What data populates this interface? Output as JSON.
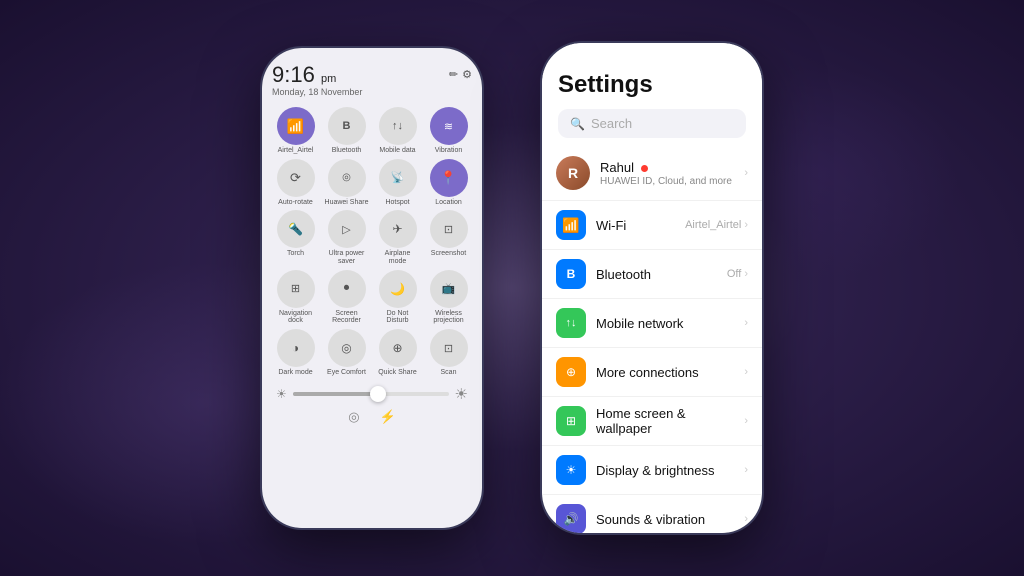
{
  "background": {
    "color": "#2d1f4a"
  },
  "left_phone": {
    "time": "9:16",
    "ampm": "pm",
    "date": "Monday, 18 November",
    "toggles": [
      {
        "id": "wifi",
        "label": "Airtel_Airtel",
        "icon": "📶",
        "active": true
      },
      {
        "id": "bluetooth",
        "label": "Bluetooth",
        "icon": "Ⅱ",
        "active": false
      },
      {
        "id": "mobile_data",
        "label": "Mobile data",
        "icon": "↑↓",
        "active": false
      },
      {
        "id": "vibration",
        "label": "Vibration",
        "icon": "≋",
        "active": true
      },
      {
        "id": "auto_rotate",
        "label": "Auto-rotate",
        "icon": "⟳",
        "active": false
      },
      {
        "id": "huawei_share",
        "label": "Huawei Share",
        "icon": "((·))",
        "active": false
      },
      {
        "id": "hotspot",
        "label": "Hotspot",
        "icon": "(·)",
        "active": false
      },
      {
        "id": "location",
        "label": "Location",
        "icon": "📍",
        "active": true
      },
      {
        "id": "torch",
        "label": "Torch",
        "icon": "🔦",
        "active": false
      },
      {
        "id": "ultra_power",
        "label": "Ultra power saver",
        "icon": "▷",
        "active": false
      },
      {
        "id": "airplane",
        "label": "Airplane mode",
        "icon": "✈",
        "active": false
      },
      {
        "id": "screenshot",
        "label": "Screenshot",
        "icon": "⊡",
        "active": false
      },
      {
        "id": "nav_dock",
        "label": "Navigation dock",
        "icon": "⊞",
        "active": false
      },
      {
        "id": "screen_rec",
        "label": "Screen Recorder",
        "icon": "⏺",
        "active": false
      },
      {
        "id": "do_not_disturb",
        "label": "Do Not Disturb",
        "icon": "🌙",
        "active": false
      },
      {
        "id": "wireless_proj",
        "label": "Wireless projection",
        "icon": "⊡",
        "active": false
      },
      {
        "id": "dark_mode",
        "label": "Dark mode",
        "icon": "◑",
        "active": false
      },
      {
        "id": "eye_comfort",
        "label": "Eye Comfort",
        "icon": "◎",
        "active": false
      },
      {
        "id": "quick_share",
        "label": "Quick Share",
        "icon": "⊕",
        "active": false
      },
      {
        "id": "scan",
        "label": "Scan",
        "icon": "⊡",
        "active": false
      }
    ],
    "brightness": 55
  },
  "right_phone": {
    "title": "Settings",
    "search_placeholder": "Search",
    "profile": {
      "name": "Rahul",
      "subtitle": "HUAWEI ID, Cloud, and more",
      "has_dot": true
    },
    "items": [
      {
        "id": "wifi",
        "label": "Wi-Fi",
        "value": "Airtel_Airtel",
        "icon_char": "📶",
        "icon_class": "icon-wifi"
      },
      {
        "id": "bluetooth",
        "label": "Bluetooth",
        "value": "Off",
        "icon_char": "Ⅱ",
        "icon_class": "icon-bt"
      },
      {
        "id": "mobile_network",
        "label": "Mobile network",
        "value": "",
        "icon_char": "↑↓",
        "icon_class": "icon-mobile"
      },
      {
        "id": "more_connections",
        "label": "More connections",
        "value": "",
        "icon_char": "⊕",
        "icon_class": "icon-conn"
      },
      {
        "id": "home_screen",
        "label": "Home screen & wallpaper",
        "value": "",
        "icon_char": "⊞",
        "icon_class": "icon-home"
      },
      {
        "id": "display",
        "label": "Display & brightness",
        "value": "",
        "icon_char": "☀",
        "icon_class": "icon-display"
      },
      {
        "id": "sounds",
        "label": "Sounds & vibration",
        "value": "",
        "icon_char": "🔊",
        "icon_class": "icon-sound"
      }
    ]
  }
}
